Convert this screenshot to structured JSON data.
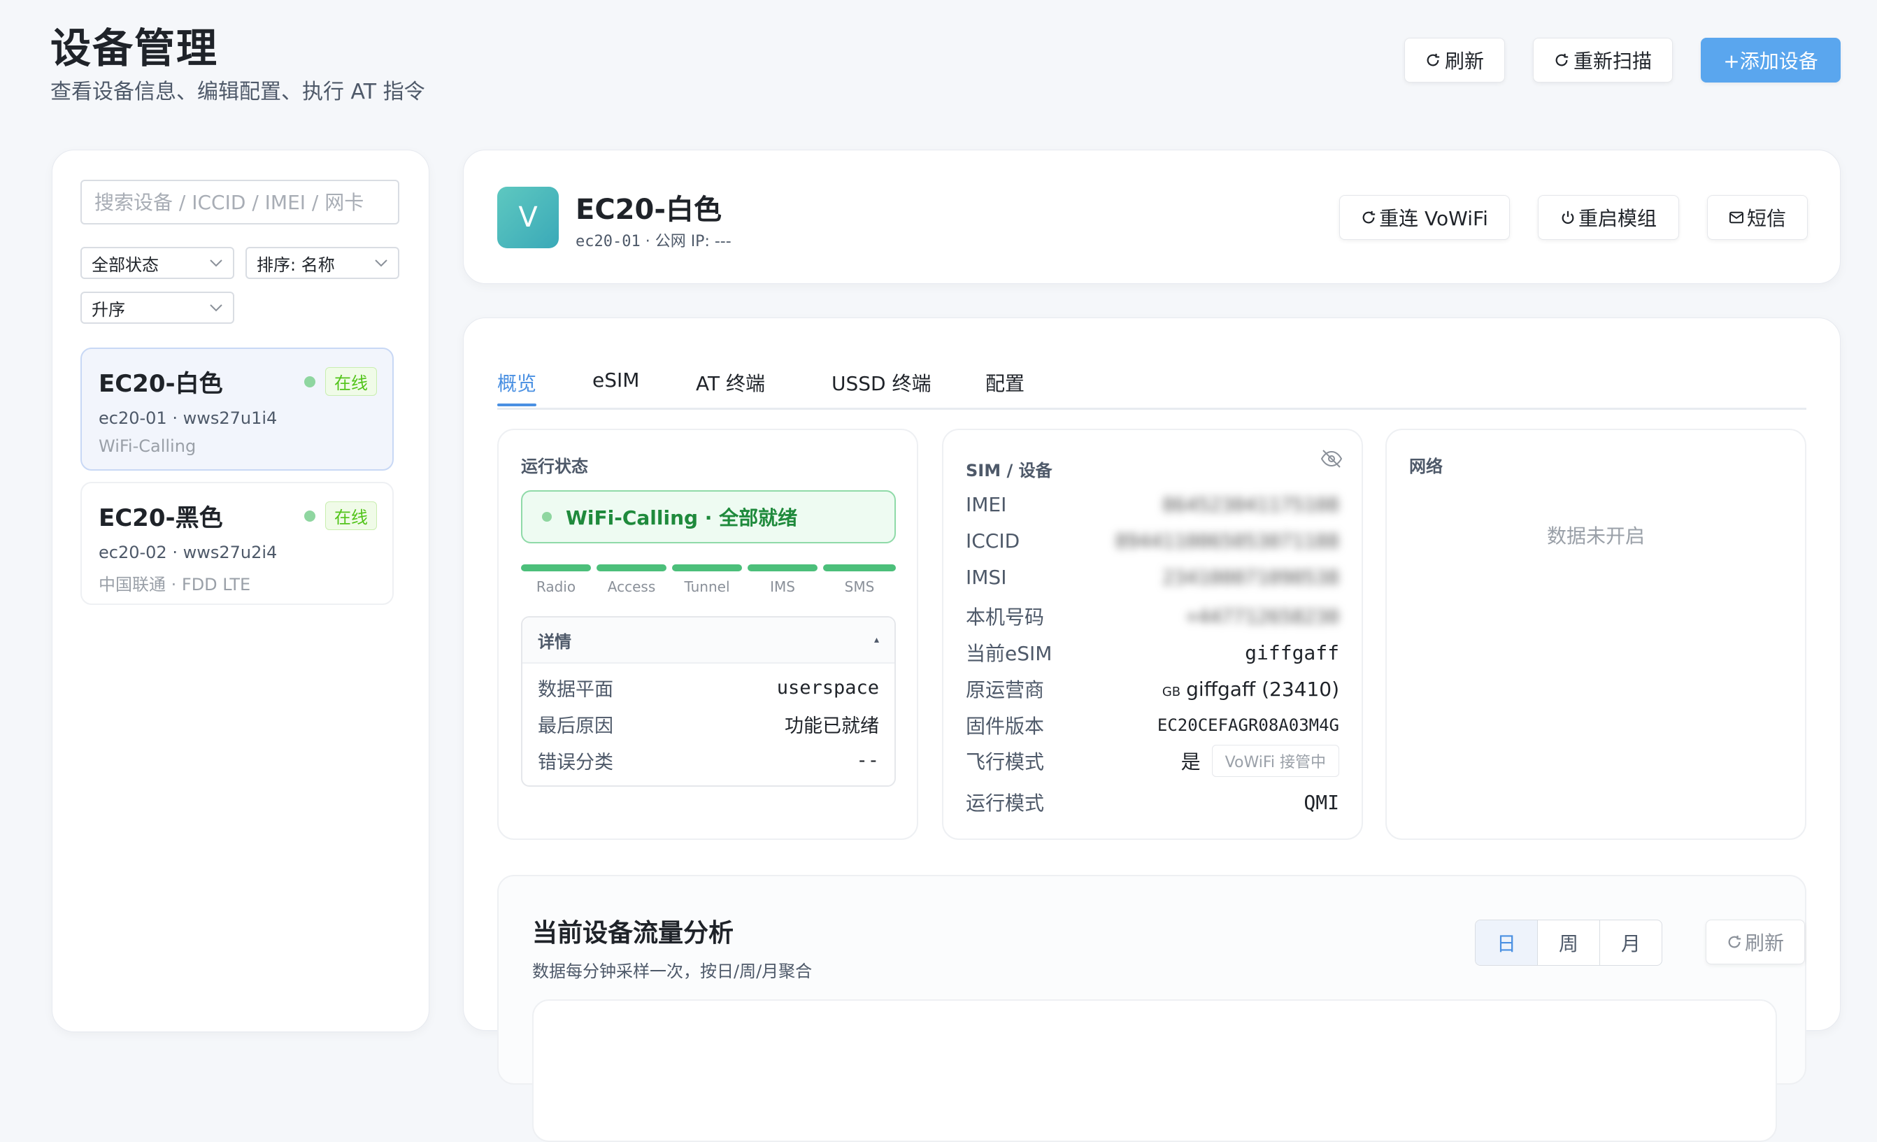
{
  "header": {
    "title": "设备管理",
    "subtitle": "查看设备信息、编辑配置、执行 AT 指令",
    "refresh_label": "刷新",
    "rescan_label": "重新扫描",
    "add_label": "+添加设备"
  },
  "sidebar": {
    "search_placeholder": "搜索设备 / ICCID / IMEI / 网卡",
    "filter_status": "全部状态",
    "sort_by": "排序: 名称",
    "sort_order": "升序",
    "devices": [
      {
        "name": "EC20-白色",
        "meta": "ec20-01 · wws27u1i4",
        "network": "WiFi-Calling",
        "status": "在线"
      },
      {
        "name": "EC20-黑色",
        "meta": "ec20-02 · wws27u2i4",
        "network": "中国联通 · FDD LTE",
        "status": "在线"
      }
    ]
  },
  "device": {
    "avatar_letter": "V",
    "title": "EC20-白色",
    "id": "ec20-01",
    "public_ip_text": " · 公网 IP: ---",
    "reconnect_label": "重连 VoWiFi",
    "restart_label": "重启模组",
    "sms_label": "短信"
  },
  "tabs": [
    "概览",
    "eSIM",
    "AT 终端",
    "USSD 终端",
    "配置"
  ],
  "run_status": {
    "title": "运行状态",
    "pill": "WiFi-Calling · 全部就绪",
    "stages": [
      "Radio",
      "Access",
      "Tunnel",
      "IMS",
      "SMS"
    ],
    "details_title": "详情",
    "details_toggle": "▴",
    "details": [
      {
        "k": "数据平面",
        "v": "userspace"
      },
      {
        "k": "最后原因",
        "v": "功能已就绪"
      },
      {
        "k": "错误分类",
        "v": "--"
      }
    ]
  },
  "sim": {
    "title": "SIM / 设备",
    "imei_label": "IMEI",
    "imei": "864523041175108",
    "iccid_label": "ICCID",
    "iccid": "8944110065053071188",
    "imsi_label": "IMSI",
    "imsi": "234100071090538",
    "phone_label": "本机号码",
    "phone": "+447712658230",
    "esim_label": "当前eSIM",
    "esim": "giffgaff",
    "carrier_label": "原运营商",
    "carrier_cc": "GB",
    "carrier": "giffgaff (23410)",
    "fw_label": "固件版本",
    "fw": "EC20CEFAGR08A03M4G",
    "airplane_label": "飞行模式",
    "airplane": "是",
    "airplane_btn": "VoWiFi 接管中",
    "mode_label": "运行模式",
    "mode": "QMI"
  },
  "network": {
    "title": "网络",
    "empty": "数据未开启"
  },
  "traffic": {
    "title": "当前设备流量分析",
    "subtitle": "数据每分钟采样一次，按日/周/月聚合",
    "periods": [
      "日",
      "周",
      "月"
    ],
    "refresh_label": "刷新"
  },
  "colors": {
    "accent": "#4a90e2",
    "primary_button": "#5aa6ee",
    "online": "#52c41a",
    "ready": "#4cbf7a"
  }
}
